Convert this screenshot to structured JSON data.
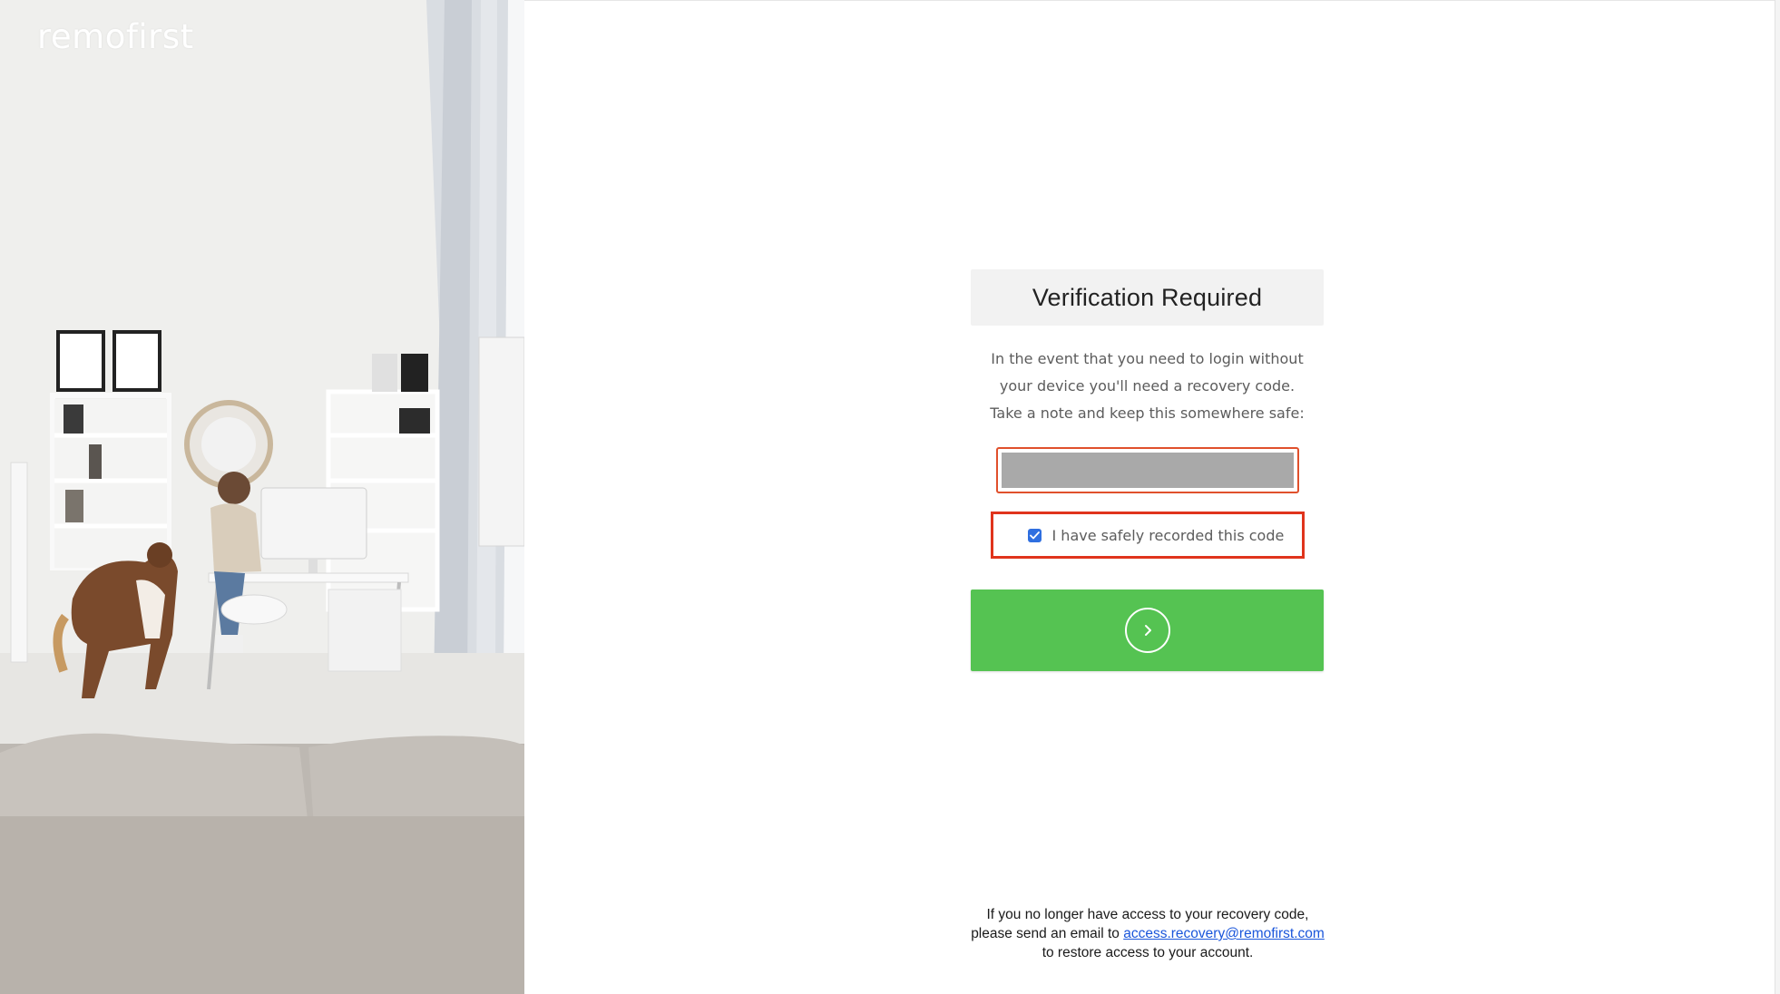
{
  "brand": {
    "logo_text": "remofirst"
  },
  "verification": {
    "title": "Verification Required",
    "instructions": [
      "In the event that you need to login without",
      "your device you'll need a recovery code.",
      "Take a note and keep this somewhere safe:"
    ],
    "recovery_code": "",
    "confirm_checkbox": {
      "label": "I have safely recorded this code",
      "checked": true
    },
    "continue_button": {
      "icon": "chevron-right-icon"
    }
  },
  "help": {
    "line1": "If you no longer have access to your recovery code,",
    "line2_prefix": "please send an email to",
    "email": "access.recovery@remofirst.com",
    "line3": "to restore access to your account."
  },
  "colors": {
    "accent_green": "#55c352",
    "link_blue": "#1a56db",
    "highlight_red": "#e0341c",
    "checkbox_blue": "#2f6fe0"
  }
}
